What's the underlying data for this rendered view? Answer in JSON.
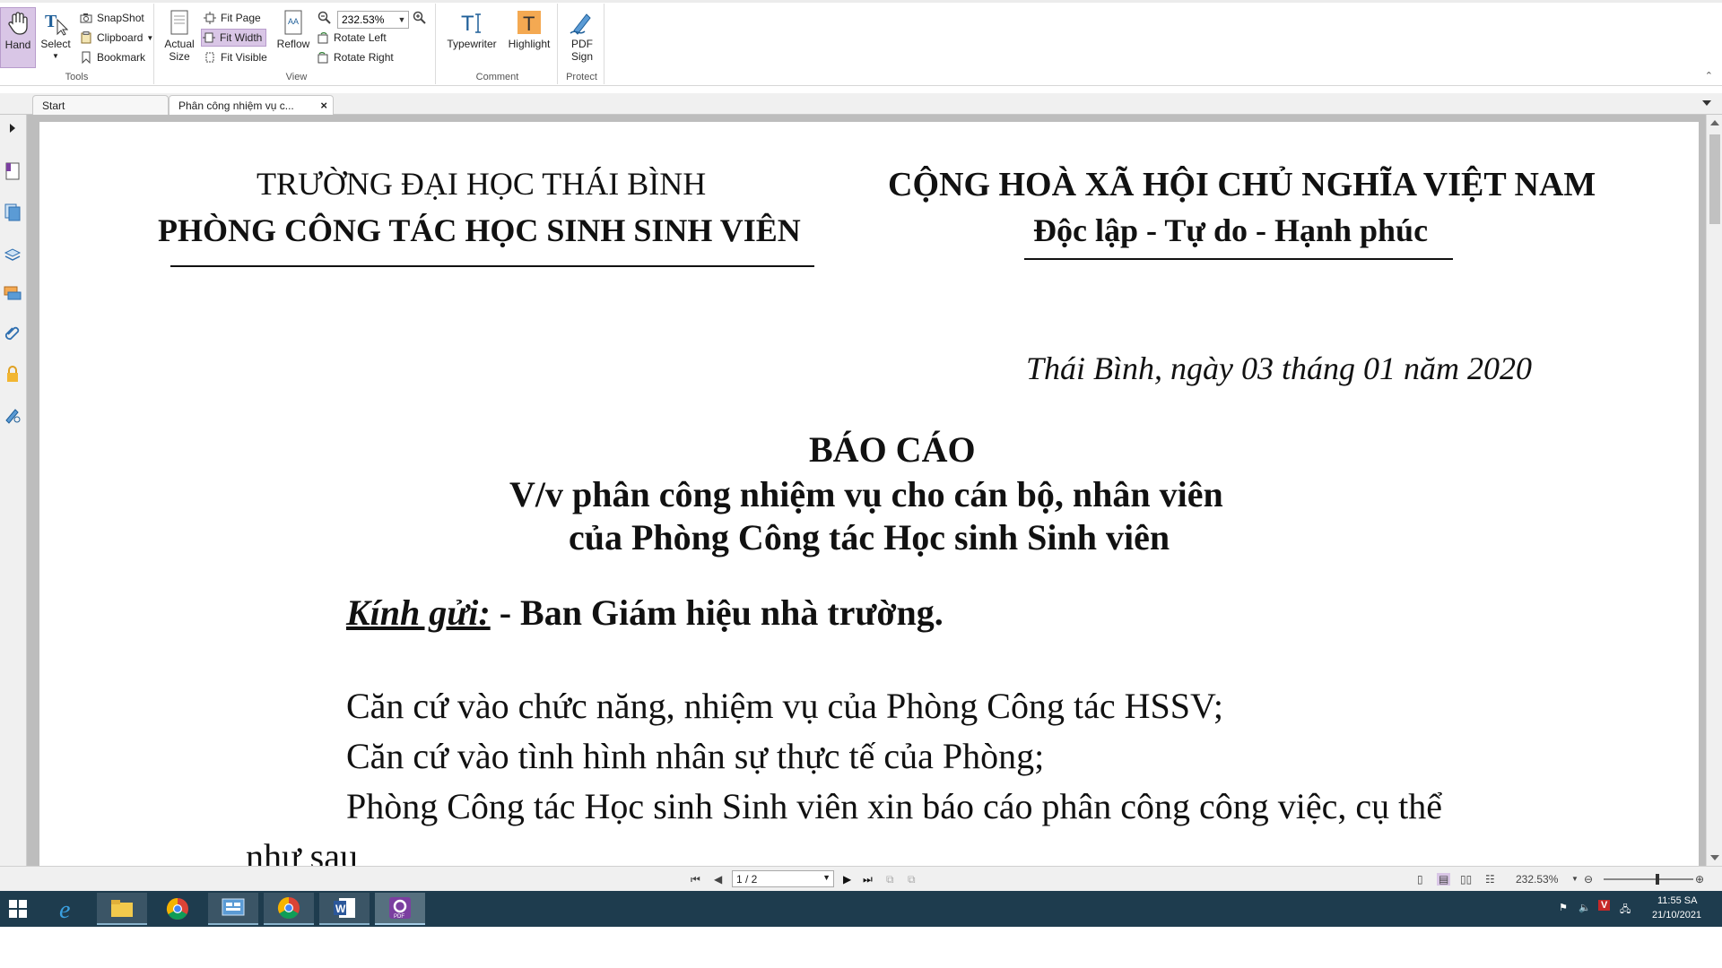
{
  "ribbon": {
    "tools": {
      "hand": "Hand",
      "select": "Select",
      "snapshot": "SnapShot",
      "clipboard": "Clipboard",
      "bookmark": "Bookmark",
      "group_label": "Tools"
    },
    "view": {
      "actual_size_1": "Actual",
      "actual_size_2": "Size",
      "fit_page": "Fit Page",
      "fit_width": "Fit Width",
      "fit_visible": "Fit Visible",
      "reflow": "Reflow",
      "zoom_value": "232.53%",
      "rotate_left": "Rotate Left",
      "rotate_right": "Rotate Right",
      "group_label": "View"
    },
    "comment": {
      "typewriter": "Typewriter",
      "highlight": "Highlight",
      "group_label": "Comment"
    },
    "protect": {
      "pdf_sign_1": "PDF",
      "pdf_sign_2": "Sign",
      "group_label": "Protect"
    }
  },
  "tabs": [
    {
      "label": "Start"
    },
    {
      "label": "Phân công nhiệm vụ c..."
    }
  ],
  "document": {
    "left_header_1": "TRƯỜNG ĐẠI HỌC THÁI BÌNH",
    "left_header_2": "PHÒNG CÔNG TÁC HỌC SINH SINH VIÊN",
    "right_header_1": "CỘNG HOÀ XÃ HỘI CHỦ NGHĨA VIỆT NAM",
    "right_header_2": "Độc lập - Tự do - Hạnh phúc",
    "date_line": "Thái Bình, ngày 03 tháng 01 năm 2020",
    "title": "BÁO CÁO",
    "subtitle_1": "V/v phân công nhiệm vụ cho cán bộ, nhân viên",
    "subtitle_2": "của Phòng Công tác Học sinh Sinh viên",
    "recipient_label": "Kính gửi:",
    "recipient_value": " - Ban Giám hiệu nhà trường.",
    "body_1": "Căn cứ vào chức năng, nhiệm vụ của Phòng Công tác HSSV;",
    "body_2": "Căn cứ vào tình hình nhân sự thực tế của Phòng;",
    "body_3": "Phòng Công tác Học sinh Sinh viên xin báo cáo phân công công việc, cụ thể",
    "body_4": "như sau"
  },
  "statusbar": {
    "page_indicator": "1 / 2",
    "zoom": "232.53%"
  },
  "taskbar": {
    "time": "11:55 SA",
    "date": "21/10/2021"
  },
  "colors": {
    "active_button": "#d9c6e6",
    "taskbar": "#1e3c4e",
    "document_background": "#bdbdbd"
  }
}
